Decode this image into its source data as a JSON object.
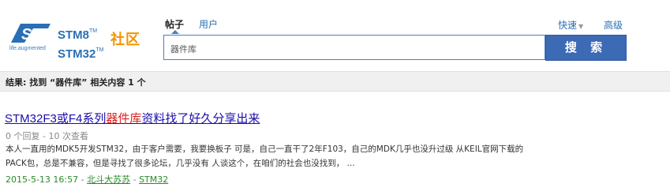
{
  "logo": {
    "tagline": "life.augmented",
    "stm8": "STM8",
    "stm32": "STM32",
    "tm": "TM",
    "community": "社区",
    "brand_blue": "#2a6fb5",
    "brand_orange": "#f29400"
  },
  "tabs": [
    {
      "label": "帖子",
      "active": true
    },
    {
      "label": "用户",
      "active": false
    }
  ],
  "header_links": {
    "quick": "快速",
    "quick_arrow": "▼",
    "advanced": "高级"
  },
  "search": {
    "value": "器件库",
    "button_label": "搜 索",
    "button_color": "#3d6ab5"
  },
  "summary": "结果: 找到 “器件库” 相关内容 1 个",
  "results": [
    {
      "title_before": "STM32F3或F4系列",
      "title_highlight": "器件库",
      "title_after": "资料找了好久分享出来",
      "stats": "0 个回复 - 10 次查看",
      "snippet_line1": "本人一直用的MDK5开发STM32，由于客户需要，我要换板子 可是，自己一直干了2年F103，自己的MDK几乎也没升过级 从KEIL官网下载的",
      "snippet_line2": "PACK包，总是不兼容，但是寻找了很多论坛，几乎没有 人谈这个，在咱们的社会也没找到， ...",
      "date": "2015-5-13 16:57",
      "separator": " - ",
      "author": "北斗大苏苏",
      "forum": "STM32",
      "highlight_color": "#e02020"
    }
  ]
}
